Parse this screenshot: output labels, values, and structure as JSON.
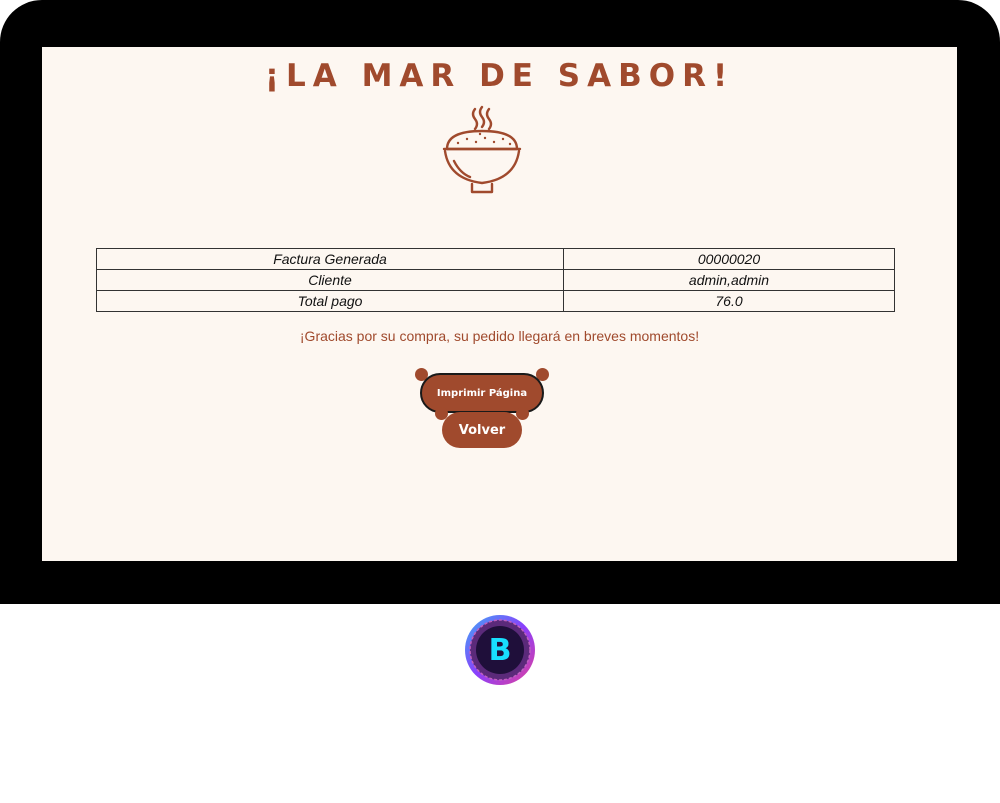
{
  "header": {
    "title": "¡LA MAR DE SABOR!",
    "logo_icon": "steaming-rice-bowl-icon"
  },
  "invoice": {
    "rows": [
      {
        "label": "Factura Generada",
        "value": "00000020"
      },
      {
        "label": "Cliente",
        "value": "admin,admin"
      },
      {
        "label": "Total pago",
        "value": "76.0"
      }
    ]
  },
  "message": "¡Gracias por su compra, su pedido llegará en breves momentos!",
  "actions": {
    "print_label": "Imprimir Página",
    "back_label": "Volver"
  },
  "badge": {
    "letter": "B",
    "icon": "b-logo-badge-icon"
  },
  "colors": {
    "accent": "#a04a2d",
    "background": "#fdf7f1",
    "frame": "#000000"
  }
}
